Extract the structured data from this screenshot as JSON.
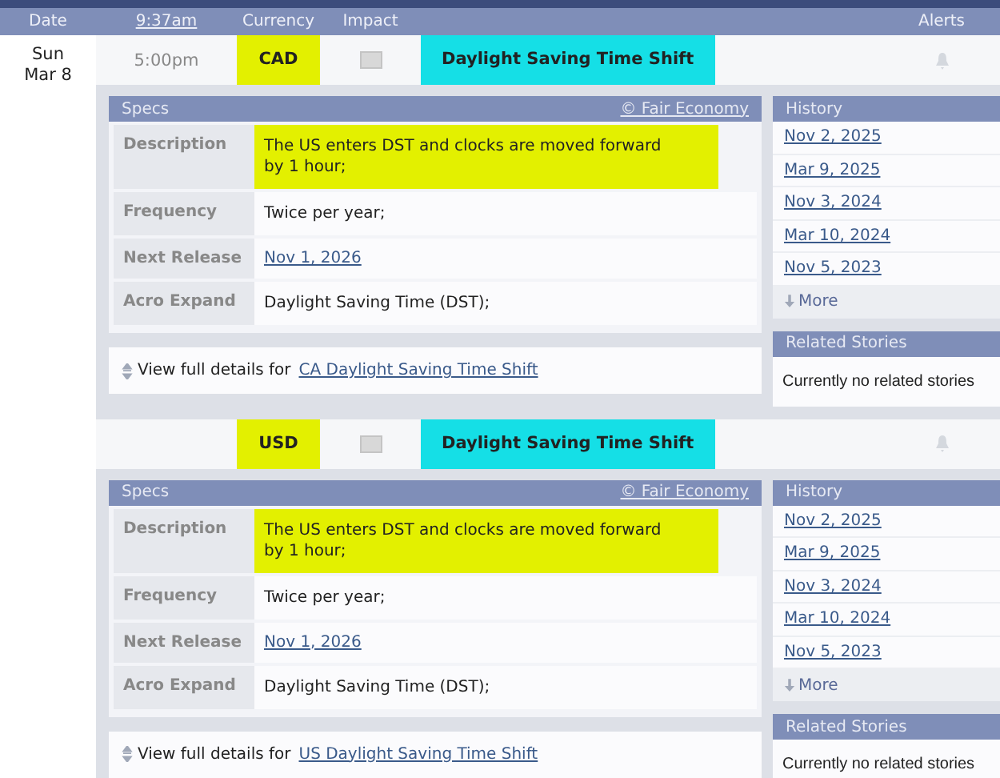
{
  "header": {
    "columns": [
      {
        "label": "Date",
        "kind": "text"
      },
      {
        "label": "9:37am",
        "kind": "link"
      },
      {
        "label": "Currency",
        "kind": "text"
      },
      {
        "label": "Impact",
        "kind": "text"
      },
      {
        "label": "Alerts",
        "kind": "text"
      }
    ]
  },
  "date": {
    "day": "Sun",
    "date": "Mar 8"
  },
  "events": [
    {
      "time": "5:00pm",
      "currency": "CAD",
      "currency_highlighted": true,
      "title": "Daylight Saving Time Shift",
      "title_highlighted": true,
      "specs": {
        "title": "Specs",
        "source": "© Fair Economy",
        "rows": [
          {
            "label": "Description",
            "value": "The US enters DST and clocks are moved forward by 1 hour;",
            "kind": "text",
            "highlighted": true
          },
          {
            "label": "Frequency",
            "value": "Twice per year;",
            "kind": "text",
            "highlighted": false
          },
          {
            "label": "Next Release",
            "value": "Nov 1, 2026",
            "kind": "link",
            "highlighted": false
          },
          {
            "label": "Acro Expand",
            "value": "Daylight Saving Time (DST);",
            "kind": "text",
            "highlighted": false
          }
        ],
        "details_prefix": "View full details for",
        "details_link": "CA Daylight Saving Time Shift"
      },
      "history": {
        "title": "History",
        "items": [
          "Nov 2, 2025",
          "Mar 9, 2025",
          "Nov 3, 2024",
          "Mar 10, 2024",
          "Nov 5, 2023"
        ],
        "more": "More"
      },
      "related": {
        "title": "Related Stories",
        "text": "Currently no related stories"
      }
    },
    {
      "currency": "USD",
      "currency_highlighted": true,
      "title": "Daylight Saving Time Shift",
      "title_highlighted": true,
      "specs": {
        "title": "Specs",
        "source": "© Fair Economy",
        "rows": [
          {
            "label": "Description",
            "value": "The US enters DST and clocks are moved forward by 1 hour;",
            "kind": "text",
            "highlighted": true
          },
          {
            "label": "Frequency",
            "value": "Twice per year;",
            "kind": "text",
            "highlighted": false
          },
          {
            "label": "Next Release",
            "value": "Nov 1, 2026",
            "kind": "link",
            "highlighted": false
          },
          {
            "label": "Acro Expand",
            "value": "Daylight Saving Time (DST);",
            "kind": "text",
            "highlighted": false
          }
        ],
        "details_prefix": "View full details for",
        "details_link": "US Daylight Saving Time Shift"
      },
      "history": {
        "title": "History",
        "items": [
          "Nov 2, 2025",
          "Mar 9, 2025",
          "Nov 3, 2024",
          "Mar 10, 2024",
          "Nov 5, 2023"
        ],
        "more": "More"
      },
      "related": {
        "title": "Related Stories",
        "text": "Currently no related stories"
      }
    }
  ]
}
